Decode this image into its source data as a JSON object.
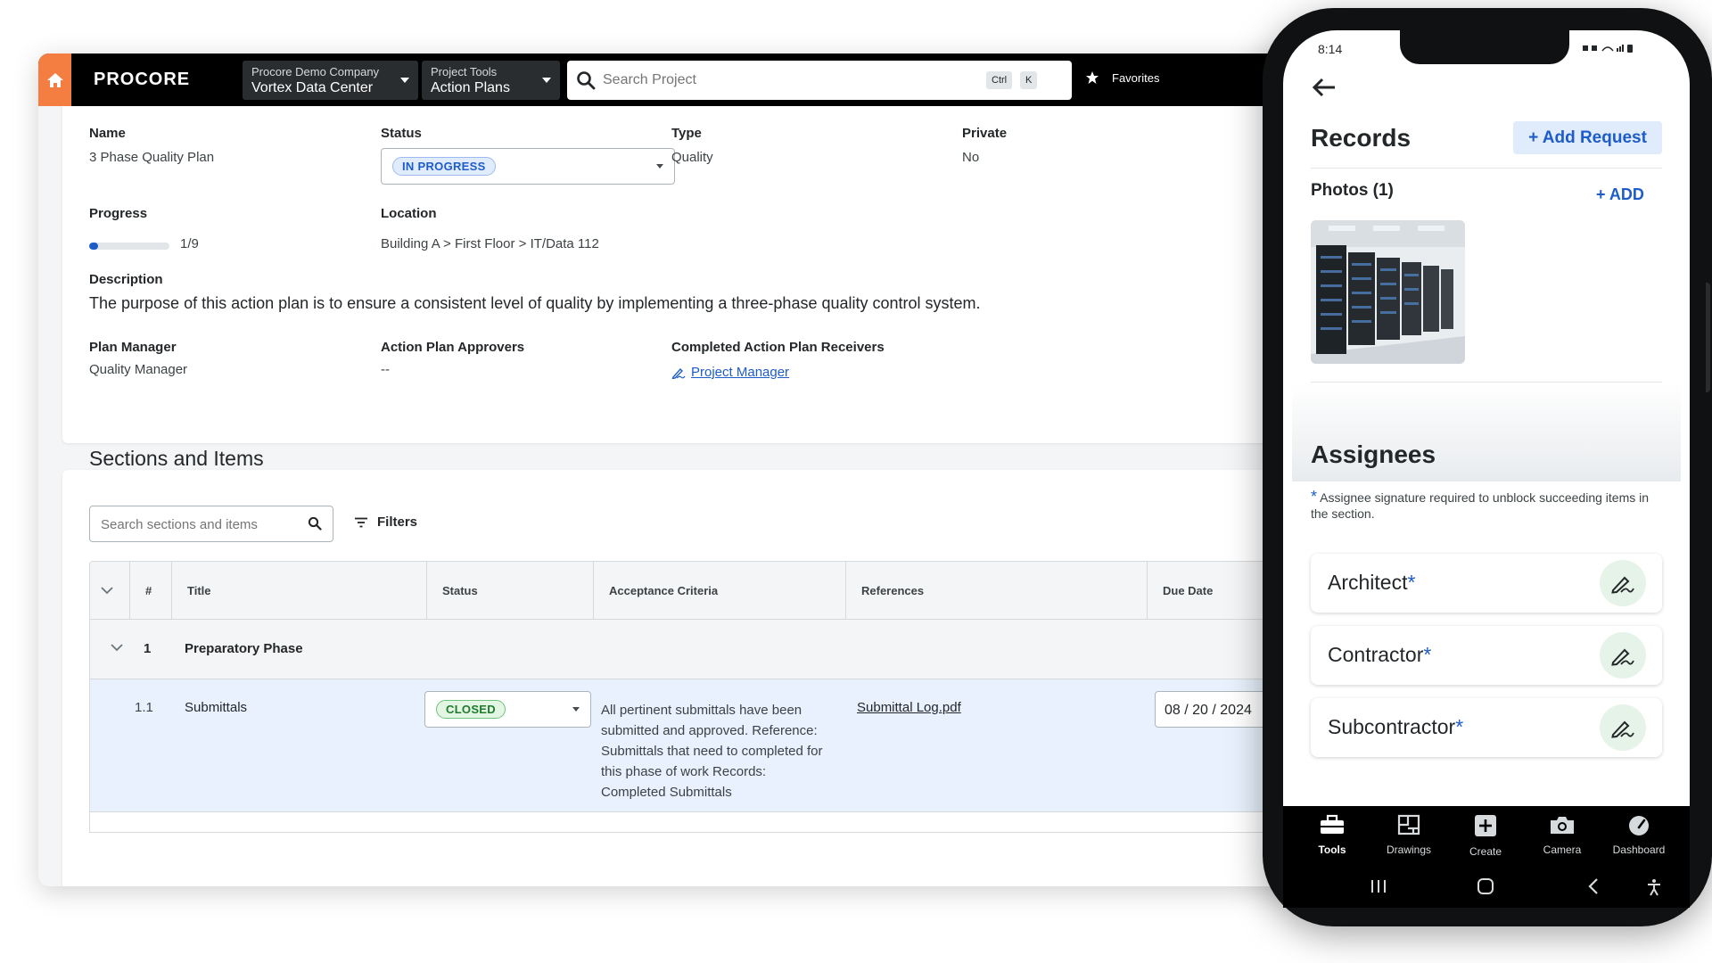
{
  "header": {
    "logo": "PROCORE",
    "company": {
      "small": "Procore Demo Company",
      "big": "Vortex Data Center"
    },
    "tool": {
      "small": "Project Tools",
      "big": "Action Plans"
    },
    "search_placeholder": "Search Project",
    "kbd_ctrl": "Ctrl",
    "kbd_k": "K",
    "favorites": "Favorites"
  },
  "plan": {
    "name_label": "Name",
    "name_value": "3 Phase Quality Plan",
    "status_label": "Status",
    "status_value": "IN PROGRESS",
    "type_label": "Type",
    "type_value": "Quality",
    "private_label": "Private",
    "private_value": "No",
    "progress_label": "Progress",
    "progress_text": "1/9",
    "progress_fraction": 0.11,
    "location_label": "Location",
    "location_value": "Building A > First Floor > IT/Data 112",
    "description_label": "Description",
    "description_value": "The purpose of this action plan is to ensure a consistent level of quality by implementing a three-phase quality control system.",
    "manager_label": "Plan Manager",
    "manager_value": "Quality Manager",
    "approvers_label": "Action Plan Approvers",
    "approvers_value": "--",
    "receivers_label": "Completed Action Plan Receivers",
    "receivers_value": "Project Manager"
  },
  "sections": {
    "title": "Sections and Items",
    "search_placeholder": "Search sections and items",
    "filters_label": "Filters",
    "columns": [
      "#",
      "Title",
      "Status",
      "Acceptance Criteria",
      "References",
      "Due Date"
    ],
    "group": {
      "number": "1",
      "title": "Preparatory Phase"
    },
    "item": {
      "number": "1.1",
      "title": "Submittals",
      "status": "CLOSED",
      "criteria": "All pertinent submittals have been submitted and approved. Reference: Submittals that need to completed for this phase of work Records: Completed Submittals",
      "reference": "Submittal Log.pdf",
      "due_date": "08 / 20 / 2024"
    }
  },
  "phone": {
    "time": "8:14",
    "records_title": "Records",
    "add_request": "+ Add Request",
    "photos_label": "Photos (1)",
    "add_photo": "+ ADD",
    "assignees_title": "Assignees",
    "assignee_note": "Assignee signature required to unblock succeeding items in the section.",
    "assignees": [
      "Architect",
      "Contractor",
      "Subcontractor"
    ],
    "tabs": [
      {
        "label": "Tools",
        "icon": "toolbox-icon"
      },
      {
        "label": "Drawings",
        "icon": "drawings-icon"
      },
      {
        "label": "Create",
        "icon": "plus-square-icon"
      },
      {
        "label": "Camera",
        "icon": "camera-icon"
      },
      {
        "label": "Dashboard",
        "icon": "gauge-icon"
      }
    ]
  },
  "colors": {
    "accent": "#f47e42",
    "link": "#1d5cc9",
    "topbar": "#000000"
  }
}
